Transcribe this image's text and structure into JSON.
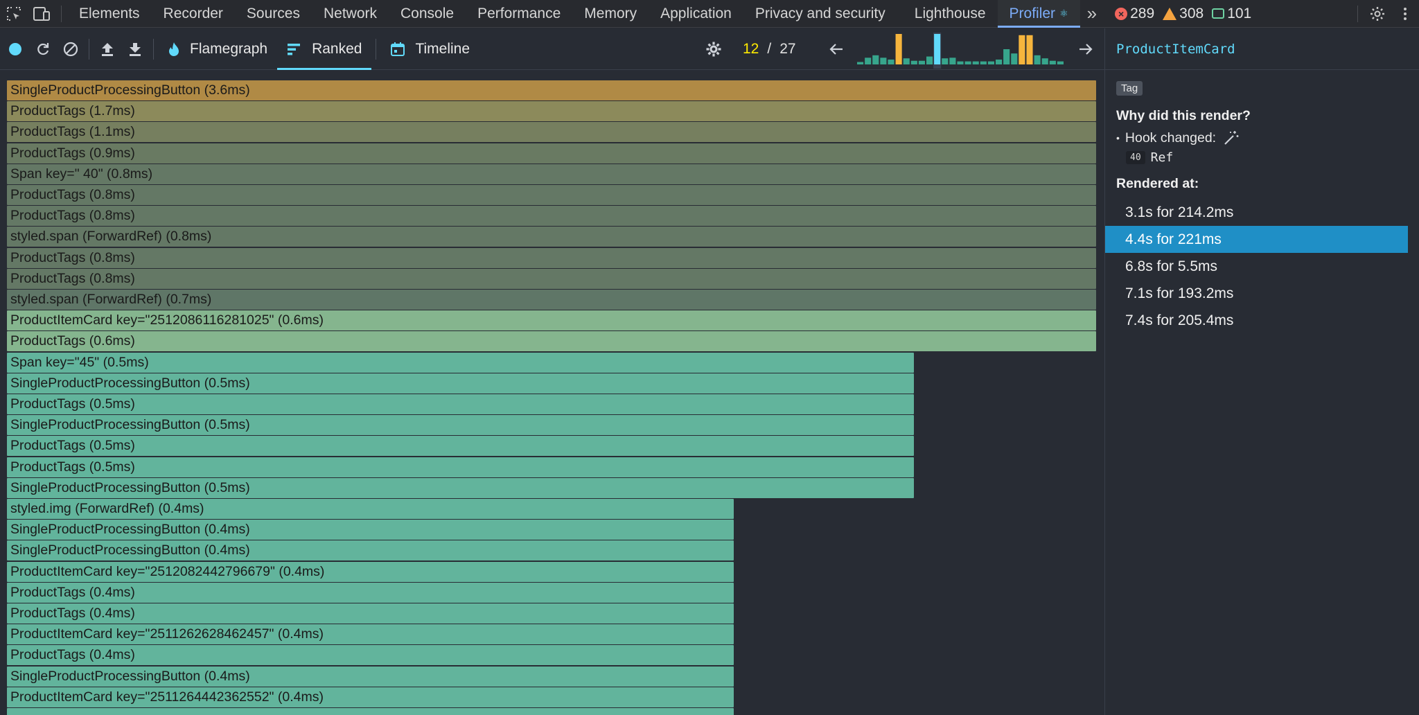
{
  "devtools_tabs": [
    {
      "label": "Elements",
      "name": "tab-elements"
    },
    {
      "label": "Recorder",
      "name": "tab-recorder"
    },
    {
      "label": "Sources",
      "name": "tab-sources"
    },
    {
      "label": "Network",
      "name": "tab-network"
    },
    {
      "label": "Console",
      "name": "tab-console"
    },
    {
      "label": "Performance",
      "name": "tab-performance"
    },
    {
      "label": "Memory",
      "name": "tab-memory"
    },
    {
      "label": "Application",
      "name": "tab-application"
    },
    {
      "label": "Privacy and security",
      "name": "tab-privacy"
    },
    {
      "label": "Lighthouse",
      "name": "tab-lighthouse"
    },
    {
      "label": "Profiler",
      "name": "tab-profiler",
      "active": true
    }
  ],
  "counters": {
    "errors": "289",
    "warnings": "308",
    "messages": "101"
  },
  "profiler_toolbar": {
    "flamegraph_label": "Flamegraph",
    "ranked_label": "Ranked",
    "timeline_label": "Timeline",
    "commit_current": "12",
    "commit_separator": "/",
    "commit_total": "27"
  },
  "commit_bars": [
    {
      "height": 0.08,
      "color": "#37a58c"
    },
    {
      "height": 0.22,
      "color": "#37a58c"
    },
    {
      "height": 0.3,
      "color": "#37a58c"
    },
    {
      "height": 0.22,
      "color": "#37a58c"
    },
    {
      "height": 0.16,
      "color": "#37a58c"
    },
    {
      "height": 1.0,
      "color": "#f6b53d"
    },
    {
      "height": 0.2,
      "color": "#37a58c"
    },
    {
      "height": 0.12,
      "color": "#37a58c"
    },
    {
      "height": 0.12,
      "color": "#37a58c"
    },
    {
      "height": 0.26,
      "color": "#37a58c"
    },
    {
      "height": 1.0,
      "color": "#61dafb",
      "selected": true
    },
    {
      "height": 0.2,
      "color": "#37a58c"
    },
    {
      "height": 0.22,
      "color": "#37a58c"
    },
    {
      "height": 0.1,
      "color": "#37a58c"
    },
    {
      "height": 0.1,
      "color": "#37a58c"
    },
    {
      "height": 0.1,
      "color": "#37a58c"
    },
    {
      "height": 0.1,
      "color": "#37a58c"
    },
    {
      "height": 0.1,
      "color": "#37a58c"
    },
    {
      "height": 0.16,
      "color": "#37a58c"
    },
    {
      "height": 0.5,
      "color": "#37a58c"
    },
    {
      "height": 0.36,
      "color": "#37a58c"
    },
    {
      "height": 0.96,
      "color": "#f6b53d"
    },
    {
      "height": 0.96,
      "color": "#f6b53d"
    },
    {
      "height": 0.3,
      "color": "#37a58c"
    },
    {
      "height": 0.2,
      "color": "#37a58c"
    },
    {
      "height": 0.12,
      "color": "#37a58c"
    },
    {
      "height": 0.1,
      "color": "#37a58c"
    }
  ],
  "ranked_items": [
    {
      "label": "SingleProductProcessingButton (3.6ms)",
      "fraction": 1.0,
      "color": "#b08a45"
    },
    {
      "label": "ProductTags (1.7ms)",
      "fraction": 1.0,
      "color": "#8c8a5b"
    },
    {
      "label": "ProductTags (1.1ms)",
      "fraction": 1.0,
      "color": "#767f5f"
    },
    {
      "label": "ProductTags (0.9ms)",
      "fraction": 1.0,
      "color": "#697a62"
    },
    {
      "label": "Span key=\" 40\" (0.8ms)",
      "fraction": 1.0,
      "color": "#647865"
    },
    {
      "label": "ProductTags (0.8ms)",
      "fraction": 1.0,
      "color": "#647865"
    },
    {
      "label": "ProductTags (0.8ms)",
      "fraction": 1.0,
      "color": "#647865"
    },
    {
      "label": "styled.span (ForwardRef) (0.8ms)",
      "fraction": 1.0,
      "color": "#647865"
    },
    {
      "label": "ProductTags (0.8ms)",
      "fraction": 1.0,
      "color": "#647865"
    },
    {
      "label": "ProductTags (0.8ms)",
      "fraction": 1.0,
      "color": "#647865"
    },
    {
      "label": "styled.span (ForwardRef) (0.7ms)",
      "fraction": 1.0,
      "color": "#5f7667"
    },
    {
      "label": "ProductItemCard key=\"2512086116281025\" (0.6ms)",
      "fraction": 1.0,
      "color": "#85b58e"
    },
    {
      "label": "ProductTags (0.6ms)",
      "fraction": 1.0,
      "color": "#85b58e"
    },
    {
      "label": "Span key=\"45\" (0.5ms)",
      "fraction": 0.833,
      "color": "#62b49c"
    },
    {
      "label": "SingleProductProcessingButton (0.5ms)",
      "fraction": 0.833,
      "color": "#62b49c"
    },
    {
      "label": "ProductTags (0.5ms)",
      "fraction": 0.833,
      "color": "#62b49c"
    },
    {
      "label": "SingleProductProcessingButton (0.5ms)",
      "fraction": 0.833,
      "color": "#62b49c"
    },
    {
      "label": "ProductTags (0.5ms)",
      "fraction": 0.833,
      "color": "#62b49c"
    },
    {
      "label": "ProductTags (0.5ms)",
      "fraction": 0.833,
      "color": "#62b49c"
    },
    {
      "label": "SingleProductProcessingButton (0.5ms)",
      "fraction": 0.833,
      "color": "#62b49c"
    },
    {
      "label": "styled.img (ForwardRef) (0.4ms)",
      "fraction": 0.667,
      "color": "#62b49c"
    },
    {
      "label": "SingleProductProcessingButton (0.4ms)",
      "fraction": 0.667,
      "color": "#62b49c"
    },
    {
      "label": "SingleProductProcessingButton (0.4ms)",
      "fraction": 0.667,
      "color": "#62b49c"
    },
    {
      "label": "ProductItemCard key=\"2512082442796679\" (0.4ms)",
      "fraction": 0.667,
      "color": "#62b49c"
    },
    {
      "label": "ProductTags (0.4ms)",
      "fraction": 0.667,
      "color": "#62b49c"
    },
    {
      "label": "ProductTags (0.4ms)",
      "fraction": 0.667,
      "color": "#62b49c"
    },
    {
      "label": "ProductItemCard key=\"2511262628462457\" (0.4ms)",
      "fraction": 0.667,
      "color": "#62b49c"
    },
    {
      "label": "ProductTags (0.4ms)",
      "fraction": 0.667,
      "color": "#62b49c"
    },
    {
      "label": "SingleProductProcessingButton (0.4ms)",
      "fraction": 0.667,
      "color": "#62b49c"
    },
    {
      "label": "ProductItemCard key=\"2511264442362552\" (0.4ms)",
      "fraction": 0.667,
      "color": "#62b49c"
    },
    {
      "label": "",
      "fraction": 0.667,
      "color": "#62b49c"
    }
  ],
  "sidebar": {
    "component_name": "ProductItemCard",
    "tag_label": "Tag",
    "why_title": "Why did this render?",
    "hook_changed_label": "Hook changed:",
    "hook_id": "40",
    "hook_name": "Ref",
    "rendered_at_title": "Rendered at:",
    "renders": [
      {
        "label": "3.1s for 214.2ms"
      },
      {
        "label": "4.4s for 221ms",
        "selected": true
      },
      {
        "label": "6.8s for 5.5ms"
      },
      {
        "label": "7.1s for 193.2ms"
      },
      {
        "label": "7.4s for 205.4ms"
      }
    ]
  }
}
